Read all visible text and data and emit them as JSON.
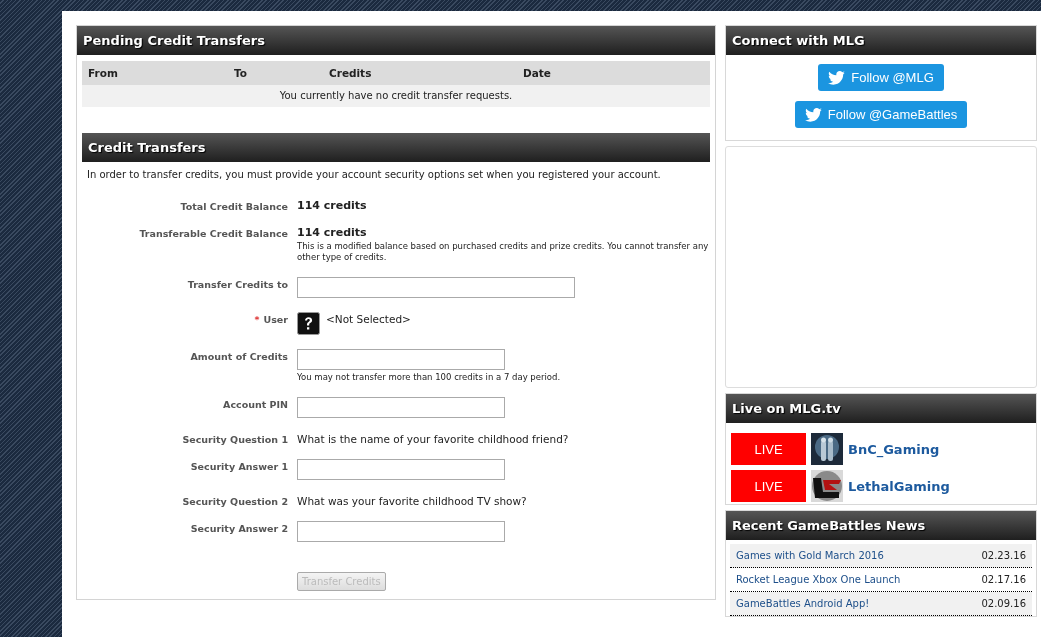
{
  "pending": {
    "title": "Pending Credit Transfers",
    "columns": [
      "From",
      "To",
      "Credits",
      "Date"
    ],
    "empty_message": "You currently have no credit transfer requests."
  },
  "transfers": {
    "title": "Credit Transfers",
    "intro": "In order to transfer credits, you must provide your account security options set when you registered your account.",
    "fields": [
      {
        "kind": "static",
        "label": "Total Credit Balance",
        "value": "114 credits"
      },
      {
        "kind": "static",
        "label": "Transferable Credit Balance",
        "value": "114 credits",
        "note": "This is a modified balance based on purchased credits and prize credits. You cannot transfer any other type of credits."
      },
      {
        "kind": "input",
        "label": "Transfer Credits to",
        "wide": true
      },
      {
        "kind": "user",
        "label": "User",
        "required_mark": "*",
        "value": "<Not Selected>"
      },
      {
        "kind": "input",
        "label": "Amount of Credits",
        "note": "You may not transfer more than 100 credits in a 7 day period."
      },
      {
        "kind": "input",
        "label": "Account PIN"
      },
      {
        "kind": "question",
        "label": "Security Question 1",
        "value": "What is the name of your favorite childhood friend?"
      },
      {
        "kind": "input",
        "label": "Security Answer 1"
      },
      {
        "kind": "question",
        "label": "Security Question 2",
        "value": "What was your favorite childhood TV show?"
      },
      {
        "kind": "input",
        "label": "Security Answer 2"
      }
    ],
    "submit": {
      "label": "Transfer Credits",
      "disabled": true
    }
  },
  "connect": {
    "title": "Connect with MLG",
    "buttons": [
      "Follow @MLG",
      "Follow @GameBattles"
    ]
  },
  "live": {
    "title": "Live on MLG.tv",
    "streams": [
      {
        "badge": "LIVE",
        "name": "BnC_Gaming"
      },
      {
        "badge": "LIVE",
        "name": "LethalGaming"
      }
    ]
  },
  "news": {
    "title": "Recent GameBattles News",
    "items": [
      {
        "title": "Games with Gold March 2016",
        "date": "02.23.16"
      },
      {
        "title": "Rocket League Xbox One Launch",
        "date": "02.17.16"
      },
      {
        "title": "GameBattles Android App!",
        "date": "02.09.16"
      }
    ]
  }
}
